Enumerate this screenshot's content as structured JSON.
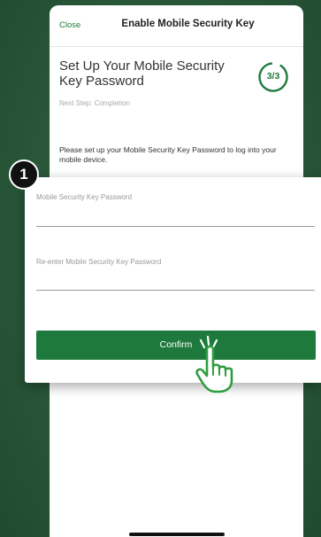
{
  "header": {
    "close_label": "Close",
    "title": "Enable Mobile Security Key"
  },
  "setup": {
    "heading_line1": "Set Up Your Mobile Security",
    "heading_line2": "Key Password",
    "step_indicator": "3/3",
    "next_step": "Next Step: Completion",
    "instruction": "Please set up your Mobile Security Key Password to log into your mobile device."
  },
  "form": {
    "password_label": "Mobile Security Key Password",
    "reenter_label": "Re-enter Mobile Security Key Password",
    "confirm_label": "Confirm"
  },
  "callout": {
    "badge_number": "1"
  },
  "colors": {
    "accent": "#1e7a3c",
    "background": "#2c5a3b"
  },
  "icons": {
    "pointer": "hand-pointer-icon",
    "progress": "progress-ring-icon"
  }
}
